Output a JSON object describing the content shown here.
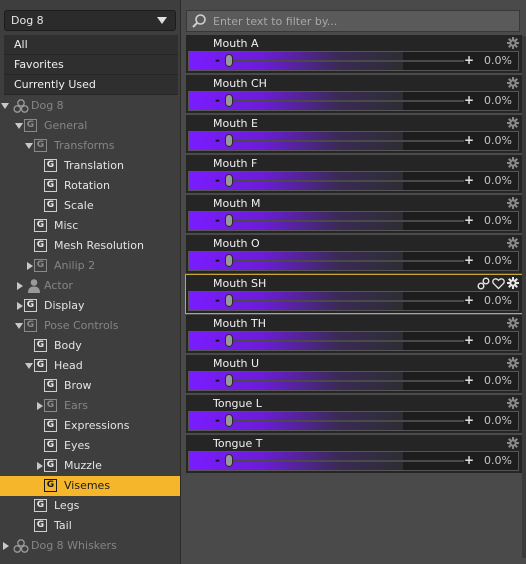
{
  "node_select": {
    "value": "Dog 8"
  },
  "filters": [
    "All",
    "Favorites",
    "Currently Used"
  ],
  "tree": [
    {
      "label": "Dog 8",
      "indent": 0,
      "twisty": "down",
      "icon": "figure",
      "dim": true
    },
    {
      "label": "General",
      "indent": 1,
      "twisty": "down",
      "icon": "G",
      "dim": true
    },
    {
      "label": "Transforms",
      "indent": 2,
      "twisty": "down",
      "icon": "G",
      "dim": true
    },
    {
      "label": "Translation",
      "indent": 3,
      "twisty": "none",
      "icon": "G"
    },
    {
      "label": "Rotation",
      "indent": 3,
      "twisty": "none",
      "icon": "G"
    },
    {
      "label": "Scale",
      "indent": 3,
      "twisty": "none",
      "icon": "G"
    },
    {
      "label": "Misc",
      "indent": 2,
      "twisty": "none",
      "icon": "G"
    },
    {
      "label": "Mesh Resolution",
      "indent": 2,
      "twisty": "none",
      "icon": "G"
    },
    {
      "label": "Anilip 2",
      "indent": 2,
      "twisty": "right",
      "icon": "G",
      "dim": true
    },
    {
      "label": "Actor",
      "indent": 1,
      "twisty": "right",
      "icon": "person",
      "dim": true
    },
    {
      "label": "Display",
      "indent": 1,
      "twisty": "right",
      "icon": "G"
    },
    {
      "label": "Pose Controls",
      "indent": 1,
      "twisty": "down",
      "icon": "G",
      "dim": true
    },
    {
      "label": "Body",
      "indent": 2,
      "twisty": "none",
      "icon": "G"
    },
    {
      "label": "Head",
      "indent": 2,
      "twisty": "down",
      "icon": "G"
    },
    {
      "label": "Brow",
      "indent": 3,
      "twisty": "none",
      "icon": "G"
    },
    {
      "label": "Ears",
      "indent": 3,
      "twisty": "right",
      "icon": "G",
      "dim": true
    },
    {
      "label": "Expressions",
      "indent": 3,
      "twisty": "none",
      "icon": "G"
    },
    {
      "label": "Eyes",
      "indent": 3,
      "twisty": "none",
      "icon": "G"
    },
    {
      "label": "Muzzle",
      "indent": 3,
      "twisty": "right",
      "icon": "G"
    },
    {
      "label": "Visemes",
      "indent": 3,
      "twisty": "none",
      "icon": "G",
      "selected": true
    },
    {
      "label": "Legs",
      "indent": 2,
      "twisty": "none",
      "icon": "G"
    },
    {
      "label": "Tail",
      "indent": 2,
      "twisty": "none",
      "icon": "G"
    },
    {
      "label": "Dog 8 Whiskers",
      "indent": 0,
      "twisty": "right",
      "icon": "figure",
      "dim": true
    }
  ],
  "search": {
    "placeholder": "Enter text to filter by..."
  },
  "sliders": [
    {
      "name": "Mouth A",
      "value": "0.0%",
      "level": 0
    },
    {
      "name": "Mouth CH",
      "value": "0.0%",
      "level": 0
    },
    {
      "name": "Mouth E",
      "value": "0.0%",
      "level": 0
    },
    {
      "name": "Mouth F",
      "value": "0.0%",
      "level": 0
    },
    {
      "name": "Mouth M",
      "value": "0.0%",
      "level": 0
    },
    {
      "name": "Mouth O",
      "value": "0.0%",
      "level": 0
    },
    {
      "name": "Mouth SH",
      "value": "0.0%",
      "level": 0,
      "active": true
    },
    {
      "name": "Mouth TH",
      "value": "0.0%",
      "level": 0
    },
    {
      "name": "Mouth U",
      "value": "0.0%",
      "level": 0
    },
    {
      "name": "Tongue L",
      "value": "0.0%",
      "level": 0
    },
    {
      "name": "Tongue T",
      "value": "0.0%",
      "level": 0
    }
  ],
  "slider_symbols": {
    "minus": "-",
    "plus": "+"
  },
  "colors": {
    "selection": "#f5b62b",
    "slider_fill": "#7a1cff",
    "active_outline": "#c9a53a"
  }
}
